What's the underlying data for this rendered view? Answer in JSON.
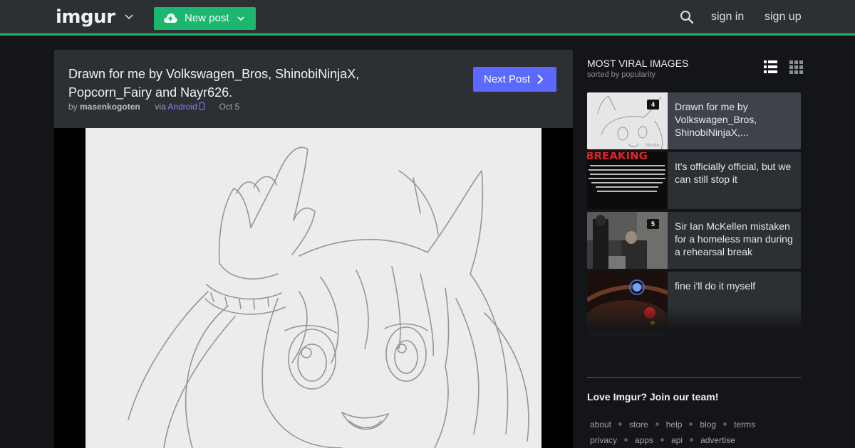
{
  "topbar": {
    "logo": "imgur",
    "new_post_label": "New post",
    "sign_in": "sign in",
    "sign_up": "sign up"
  },
  "post": {
    "title_line1": "Drawn for me by Volkswagen_Bros, ShinobiNinjaX,",
    "title_line2": "Popcorn_Fairy and Nayr626.",
    "by_label": "by",
    "author": "masenkogoten",
    "via_label": "via",
    "via_source": "Android",
    "date": "Oct 5",
    "next_post_label": "Next Post"
  },
  "sidebar": {
    "title": "MOST VIRAL IMAGES",
    "subtitle": "sorted by popularity",
    "items": [
      {
        "caption": "Drawn for me by Volkswagen_Bros, ShinobiNinjaX,...",
        "badge": "4"
      },
      {
        "caption": "It's officially official, but we can still stop it",
        "badge": "",
        "thumb_headline": "BREAKING"
      },
      {
        "caption": "Sir Ian McKellen mistaken for a homeless man during a rehearsal break",
        "badge": "5"
      },
      {
        "caption": "fine i'll do it myself",
        "badge": ""
      }
    ],
    "join_text": "Love Imgur? Join our team!",
    "footer_row1": [
      "about",
      "store",
      "help",
      "blog",
      "terms"
    ],
    "footer_row2": [
      "privacy",
      "apps",
      "api",
      "advertise"
    ]
  },
  "colors": {
    "accent_green": "#1bb76e",
    "next_button_blue": "#5c69ff",
    "panel": "#2c2f34",
    "page_bg": "#141518"
  }
}
